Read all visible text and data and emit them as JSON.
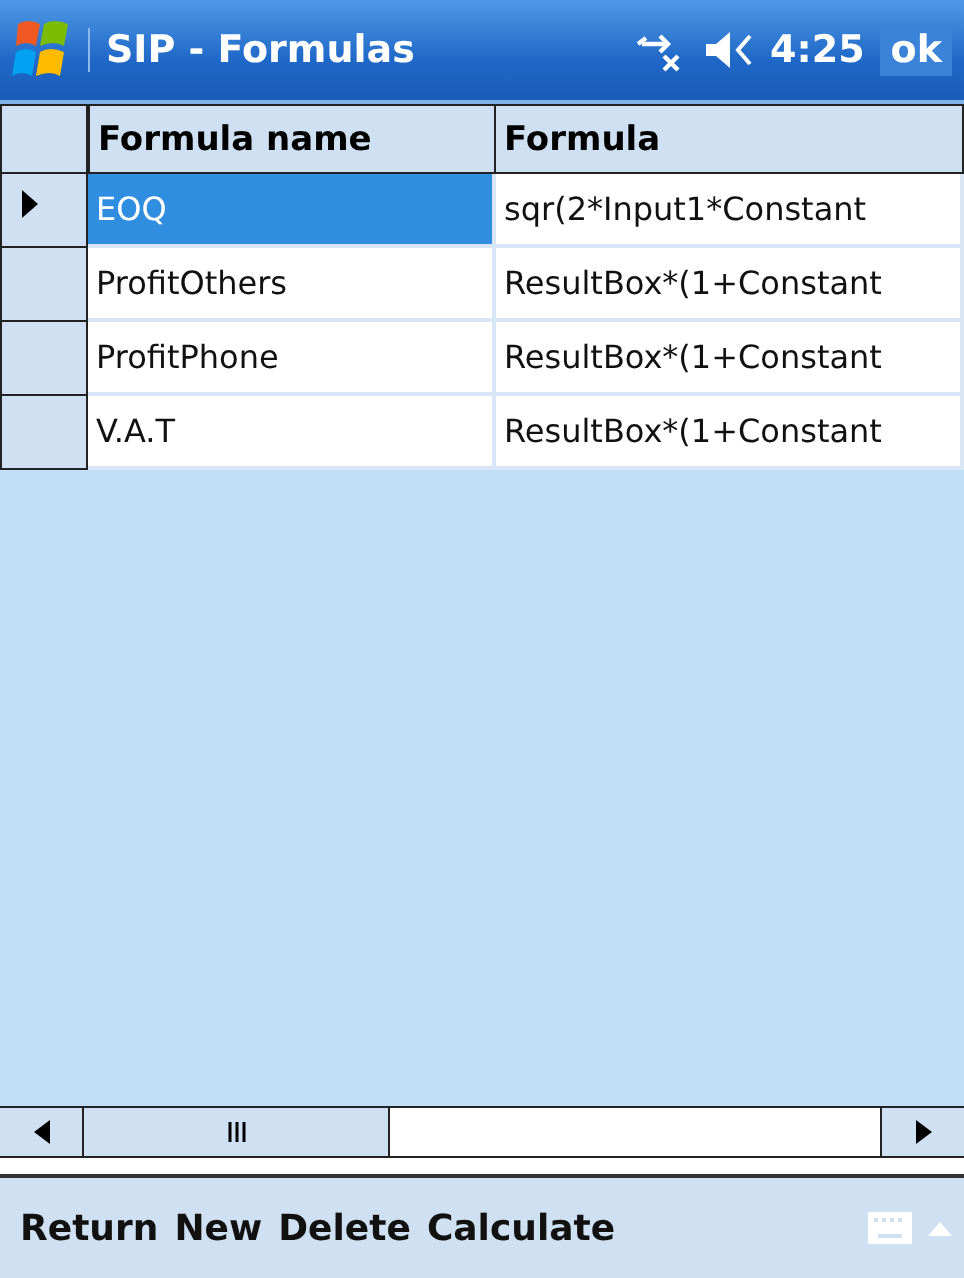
{
  "title_bar": {
    "title": "SIP - Formulas",
    "time": "4:25",
    "ok": "ok"
  },
  "table": {
    "columns": [
      "Formula name",
      "Formula"
    ],
    "rows": [
      {
        "name": "EOQ",
        "formula": "sqr(2*Input1*Constant",
        "selected": true
      },
      {
        "name": "ProfitOthers",
        "formula": "ResultBox*(1+Constant",
        "selected": false
      },
      {
        "name": "ProfitPhone",
        "formula": "ResultBox*(1+Constant",
        "selected": false
      },
      {
        "name": "V.A.T",
        "formula": "ResultBox*(1+Constant",
        "selected": false
      }
    ]
  },
  "menu_bar": [
    "Return",
    "New",
    "Delete",
    "Calculate"
  ]
}
